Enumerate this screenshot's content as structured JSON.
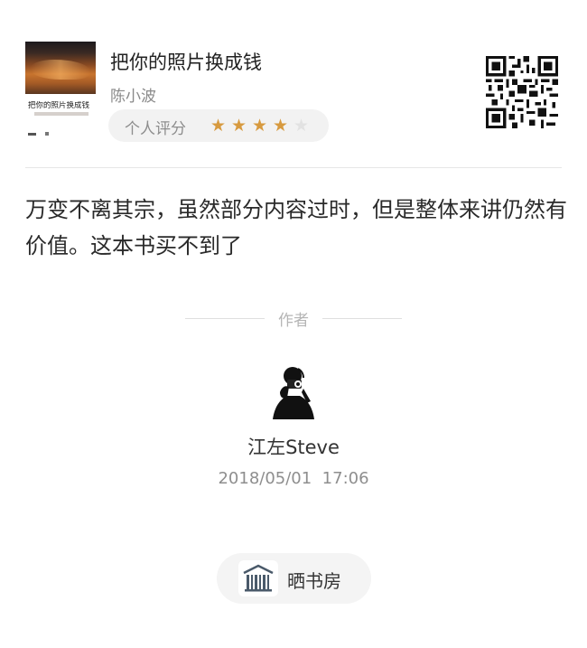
{
  "book": {
    "cover_title": "把你的照片换成钱",
    "title": "把你的照片换成钱",
    "author": "陈小波",
    "rating_label": "个人评分",
    "rating": 4,
    "rating_max": 5,
    "star_color": "#d79a3f",
    "star_off_color": "#e2e2e2"
  },
  "qr_code": {
    "icon": "qr-code-icon"
  },
  "review": {
    "text": "万变不离其宗，虽然部分内容过时，但是整体来讲仍然有价值。这本书买不到了"
  },
  "author_section": {
    "label": "作者",
    "name": "江左Steve",
    "timestamp": "2018/05/01  17:06",
    "avatar_icon": "photographer-avatar-icon"
  },
  "share_button": {
    "label": "晒书房",
    "icon": "bookshelf-icon"
  }
}
